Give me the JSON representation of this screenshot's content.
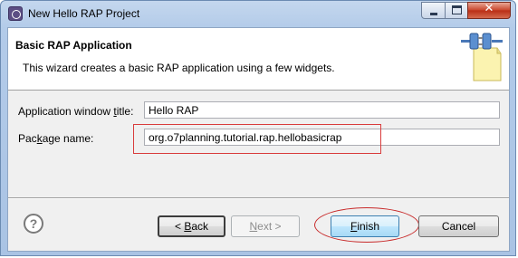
{
  "window": {
    "title": "New Hello RAP Project",
    "controls": {
      "minimize": "minimize",
      "maximize": "maximize",
      "close": "✕"
    }
  },
  "header": {
    "title": "Basic RAP Application",
    "description": "This wizard creates a basic RAP application using a few widgets.",
    "banner_icon": "wizard-plug-icon"
  },
  "form": {
    "app_title_label_pre": "Application window ",
    "app_title_label_mnemonic": "t",
    "app_title_label_post": "itle:",
    "app_title_value": "Hello RAP",
    "package_label_pre": "Pac",
    "package_label_mnemonic": "k",
    "package_label_post": "age name:",
    "package_value": "org.o7planning.tutorial.rap.hellobasicrap"
  },
  "buttons": {
    "help": "?",
    "back_pre": "< ",
    "back_mnemonic": "B",
    "back_post": "ack",
    "next_mnemonic": "N",
    "next_post": "ext >",
    "finish_mnemonic": "F",
    "finish_post": "inish",
    "cancel": "Cancel"
  },
  "colors": {
    "annotation_red": "#d93c3c",
    "titlebar": "#b3cbe9",
    "dialog_bg": "#f0f0f0"
  }
}
